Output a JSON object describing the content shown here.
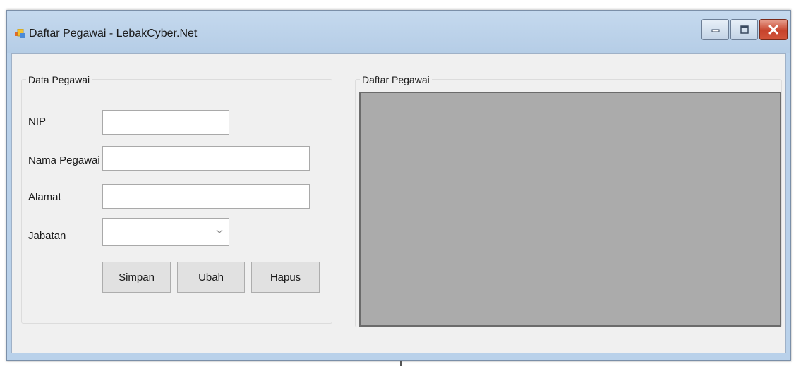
{
  "window": {
    "title": "Daftar Pegawai - LebakCyber.Net",
    "icons": {
      "app": "form-app-icon",
      "minimize": "minimize-icon",
      "maximize": "maximize-icon",
      "close": "close-icon"
    },
    "colors": {
      "titlebar": "#b9d1ea",
      "close_button": "#c7432c",
      "grid_background": "#ababab"
    }
  },
  "data_pegawai": {
    "group_title": "Data Pegawai",
    "fields": {
      "nip": {
        "label": "NIP",
        "value": ""
      },
      "nama": {
        "label": "Nama Pegawai",
        "value": ""
      },
      "alamat": {
        "label": "Alamat",
        "value": ""
      },
      "jabatan": {
        "label": "Jabatan",
        "value": ""
      }
    },
    "buttons": {
      "simpan": "Simpan",
      "ubah": "Ubah",
      "hapus": "Hapus"
    }
  },
  "daftar_pegawai": {
    "group_title": "Daftar Pegawai"
  }
}
